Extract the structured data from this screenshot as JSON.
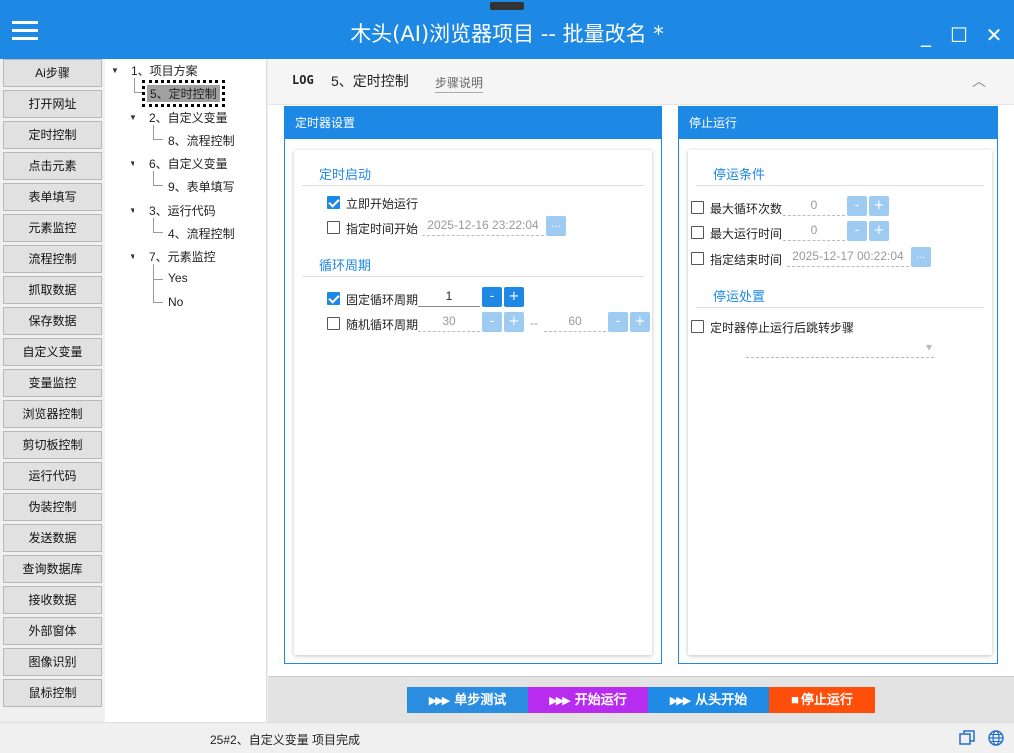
{
  "app": {
    "title": "木头(AI)浏览器项目   --   批量改名 *",
    "window": {
      "minimize": "_",
      "maximize": "☐",
      "close": "✕"
    }
  },
  "tools": [
    "Ai步骤",
    "打开网址",
    "定时控制",
    "点击元素",
    "表单填写",
    "元素监控",
    "流程控制",
    "抓取数据",
    "保存数据",
    "自定义变量",
    "变量监控",
    "浏览器控制",
    "剪切板控制",
    "运行代码",
    "伪装控制",
    "发送数据",
    "查询数据库",
    "接收数据",
    "外部窗体",
    "图像识别",
    "鼠标控制"
  ],
  "tree": {
    "n1": "1、项目方案",
    "n1_1": "5、定时控制",
    "n2": "2、自定义变量",
    "n2_1": "8、流程控制",
    "n3": "6、自定义变量",
    "n3_1": "9、表单填写",
    "n4": "3、运行代码",
    "n4_1": "4、流程控制",
    "n5": "7、元素监控",
    "n5_1": "Yes",
    "n5_2": "No"
  },
  "header": {
    "log_badge": "LOG",
    "step_title": "5、定时控制",
    "step_desc": "步骤说明",
    "collapse": "︿"
  },
  "timer_panel": {
    "heading": "定时器设置",
    "start_section": "定时启动",
    "start_now": {
      "label": "立即开始运行",
      "checked": true
    },
    "start_at": {
      "label": "指定时间开始",
      "value": "2025-12-16 23:22:04",
      "button": "...",
      "checked": false
    },
    "cycle_section": "循环周期",
    "fixed_cycle": {
      "label": "固定循环周期",
      "value": "1",
      "minus": "-",
      "plus": "+",
      "checked": true
    },
    "random_cycle": {
      "label": "随机循环周期",
      "min": "30",
      "separator": "--",
      "max": "60",
      "minus": "-",
      "plus": "+",
      "checked": false
    }
  },
  "stop_panel": {
    "heading": "停止运行",
    "cond_section": "停运条件",
    "max_loops": {
      "label": "最大循环次数",
      "value": "0",
      "minus": "-",
      "plus": "+"
    },
    "max_time": {
      "label": "最大运行时间",
      "value": "0",
      "minus": "-",
      "plus": "+"
    },
    "end_time": {
      "label": "指定结束时间",
      "value": "2025-12-17 00:22:04",
      "button": "..."
    },
    "action_section": "停运处置",
    "jump_step": {
      "label": "定时器停止运行后跳转步骤",
      "dropdown_arrow": "▾"
    }
  },
  "actions": {
    "step_test": "单步测试",
    "start_run": "开始运行",
    "restart": "从头开始",
    "stop_run": "停止运行",
    "play_icon": "▶▶▶",
    "stop_icon": "■"
  },
  "status": {
    "message": "25#2、自定义变量 项目完成"
  },
  "colors": {
    "primary": "#1e88e5",
    "light_primary": "#9ecbf2",
    "step_test": "#2b8de0",
    "start_run": "#b82cf0",
    "restart": "#1f8be6",
    "stop_run": "#ff4d0a"
  }
}
